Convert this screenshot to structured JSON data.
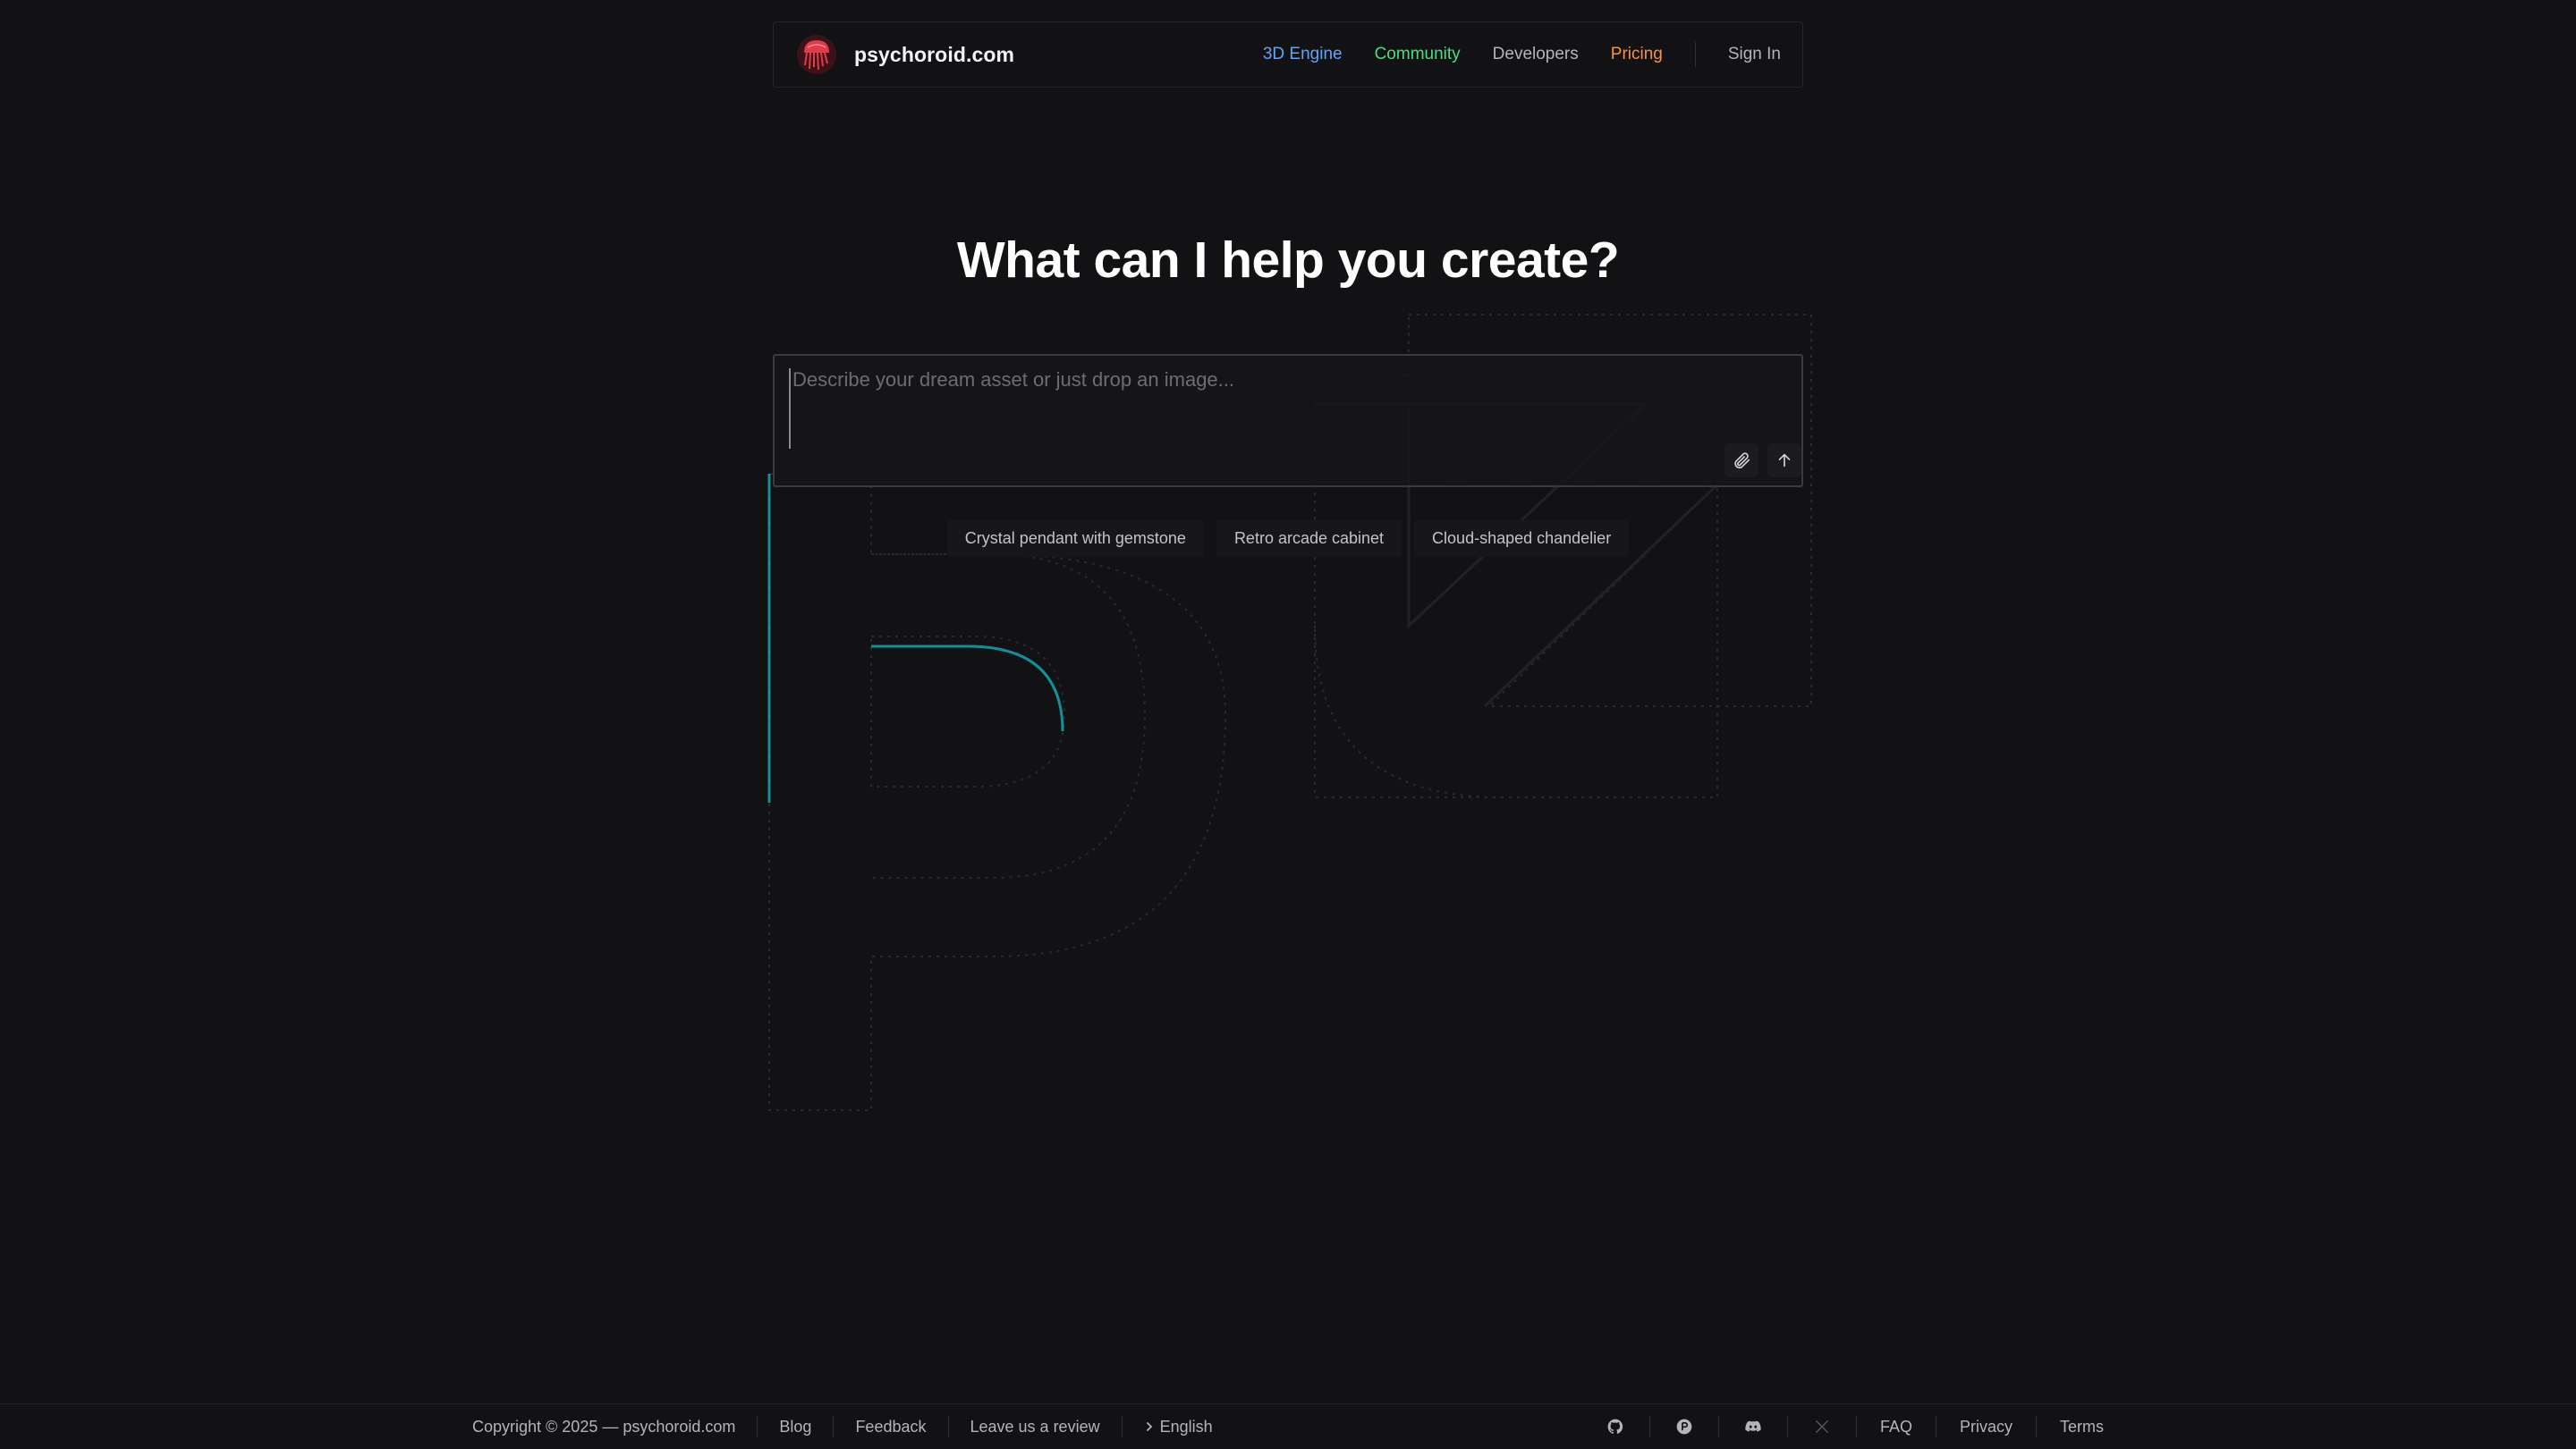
{
  "header": {
    "brand_name": "psychoroid.com",
    "nav": [
      {
        "label": "3D Engine",
        "color": "#60a5fa"
      },
      {
        "label": "Community",
        "color": "#4ade80"
      },
      {
        "label": "Developers",
        "color": "#b4b4ba"
      },
      {
        "label": "Pricing",
        "color": "#fb923c"
      }
    ],
    "sign_in_label": "Sign In"
  },
  "hero": {
    "title": "What can I help you create?",
    "prompt_placeholder": "Describe your dream asset or just drop an image...",
    "prompt_value": "",
    "suggestions": [
      "Crystal pendant with gemstone",
      "Retro arcade cabinet",
      "Cloud-shaped chandelier"
    ]
  },
  "icons": {
    "logo": "jellyfish-logo-icon",
    "attach": "paperclip-icon",
    "send": "arrow-up-icon",
    "language": "chevron-right-icon",
    "social": [
      "github-icon",
      "producthunt-icon",
      "discord-icon",
      "x-icon"
    ]
  },
  "footer": {
    "copyright": "Copyright © 2025 — psychoroid.com",
    "blog": "Blog",
    "feedback": "Feedback",
    "review": "Leave us a review",
    "language": "English",
    "faq": "FAQ",
    "privacy": "Privacy",
    "terms": "Terms"
  },
  "colors": {
    "background": "#121214",
    "accent_teal": "#14b8c8",
    "logo_red": "#e23b4a"
  }
}
